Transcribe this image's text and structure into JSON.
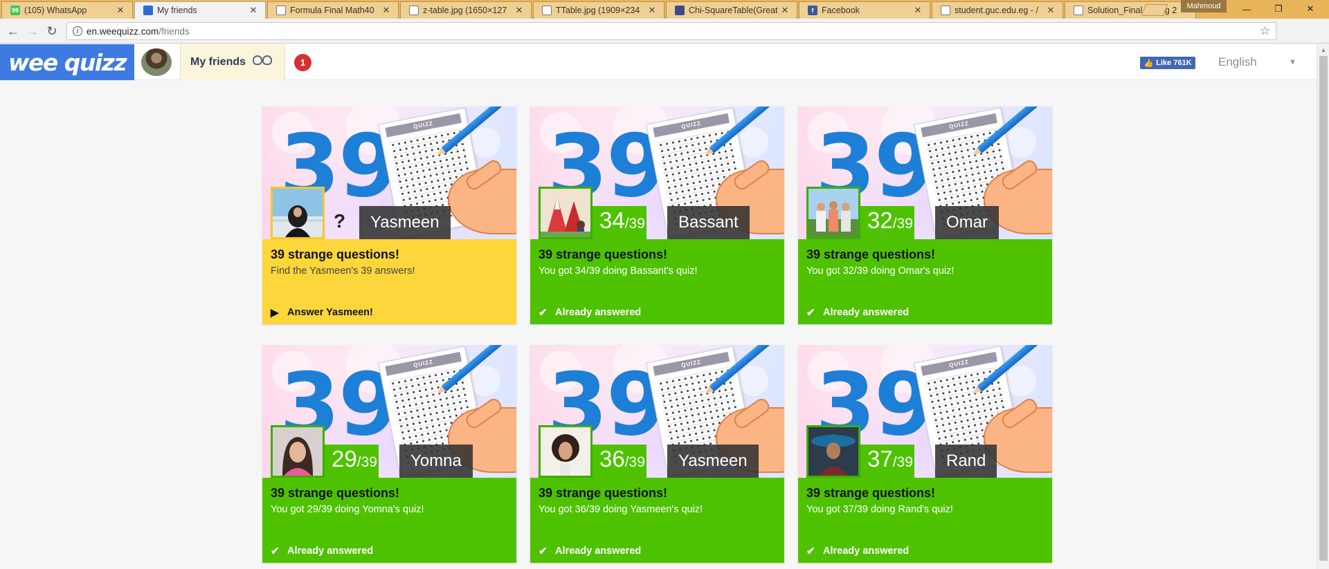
{
  "browser": {
    "tabs": [
      {
        "title": "(105) WhatsApp",
        "icon": "whatsapp-icon",
        "color": "#43c553",
        "glyph": "99",
        "active": false
      },
      {
        "title": "My friends",
        "icon": "weequizz-favicon",
        "color": "#2e6bd6",
        "glyph": "",
        "active": true
      },
      {
        "title": "Formula Final Math40",
        "icon": "document-icon",
        "color": "",
        "glyph": "",
        "active": false
      },
      {
        "title": "z-table.jpg (1650×127",
        "icon": "document-icon",
        "color": "",
        "glyph": "",
        "active": false
      },
      {
        "title": "TTable.jpg (1909×234",
        "icon": "document-icon",
        "color": "",
        "glyph": "",
        "active": false
      },
      {
        "title": "Chi-SquareTable(Great",
        "icon": "grid-icon",
        "color": "#3c4a8c",
        "glyph": "",
        "active": false
      },
      {
        "title": "Facebook",
        "icon": "facebook-icon",
        "color": "#3b5998",
        "glyph": "f",
        "active": false
      },
      {
        "title": "student.guc.edu.eg - /",
        "icon": "document-icon",
        "color": "",
        "glyph": "",
        "active": false
      },
      {
        "title": "Solution_Final Spring 2",
        "icon": "document-icon",
        "color": "",
        "glyph": "",
        "active": false
      }
    ],
    "profile_name": "Mahmoud",
    "address": {
      "host": "en.weequizz.com",
      "path": "/friends"
    }
  },
  "site": {
    "logo": "wee quizz",
    "nav": {
      "my_friends": "My friends",
      "notifications": "1"
    },
    "fb_like": "Like 761K",
    "language": "English"
  },
  "cards": [
    {
      "big_number": "39",
      "name": "Yasmeen",
      "score": "",
      "total": "",
      "pending": true,
      "title": "39 strange questions!",
      "subtitle": "Find the Yasmeen's 39 answers!",
      "action": "Answer Yasmeen!",
      "action_icon": "play-icon",
      "avatar": "person-hijab"
    },
    {
      "big_number": "39",
      "name": "Bassant",
      "score": "34",
      "total": "/39",
      "pending": false,
      "title": "39 strange questions!",
      "subtitle": "You got 34/39 doing Bassant's quiz!",
      "action": "Already answered",
      "action_icon": "check-icon",
      "avatar": "carnival"
    },
    {
      "big_number": "39",
      "name": "Omar",
      "score": "32",
      "total": "/39",
      "pending": false,
      "title": "39 strange questions!",
      "subtitle": "You got 32/39 doing Omar's quiz!",
      "action": "Already answered",
      "action_icon": "check-icon",
      "avatar": "group-three"
    },
    {
      "big_number": "39",
      "name": "Yomna",
      "score": "29",
      "total": "/39",
      "pending": false,
      "title": "39 strange questions!",
      "subtitle": "You got 29/39 doing Yomna's quiz!",
      "action": "Already answered",
      "action_icon": "check-icon",
      "avatar": "woman-pink"
    },
    {
      "big_number": "39",
      "name": "Yasmeen",
      "score": "36",
      "total": "/39",
      "pending": false,
      "title": "39 strange questions!",
      "subtitle": "You got 36/39 doing Yasmeen's quiz!",
      "action": "Already answered",
      "action_icon": "check-icon",
      "avatar": "woman-curly"
    },
    {
      "big_number": "39",
      "name": "Rand",
      "score": "37",
      "total": "/39",
      "pending": false,
      "title": "39 strange questions!",
      "subtitle": "You got 37/39 doing Rand's quiz!",
      "action": "Already answered",
      "action_icon": "check-icon",
      "avatar": "sombrero"
    }
  ],
  "sheet_heading": "QUIZZ"
}
